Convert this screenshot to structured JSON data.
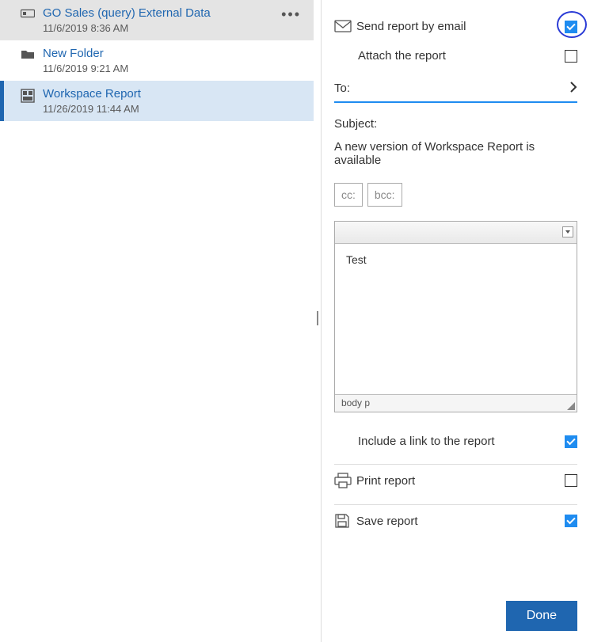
{
  "left": {
    "items": [
      {
        "name": "GO Sales (query) External Data",
        "meta": "11/6/2019 8:36 AM",
        "icon": "report",
        "state": "hover",
        "kebab": true
      },
      {
        "name": "New Folder",
        "meta": "11/6/2019 9:21 AM",
        "icon": "folder",
        "state": ""
      },
      {
        "name": "Workspace Report",
        "meta": "11/26/2019 11:44 AM",
        "icon": "workspace",
        "state": "selected"
      }
    ]
  },
  "right": {
    "send_label": "Send report by email",
    "send_checked": true,
    "attach_label": "Attach the report",
    "attach_checked": false,
    "to_label": "To:",
    "subject_label": "Subject:",
    "subject_value": "A new version of Workspace Report is available",
    "cc_label": "cc:",
    "bcc_label": "bcc:",
    "body_text": "Test",
    "status_path": "body   p",
    "include_link_label": "Include a link to the report",
    "include_link_checked": true,
    "print_label": "Print report",
    "print_checked": false,
    "save_label": "Save report",
    "save_checked": true,
    "done_label": "Done"
  }
}
